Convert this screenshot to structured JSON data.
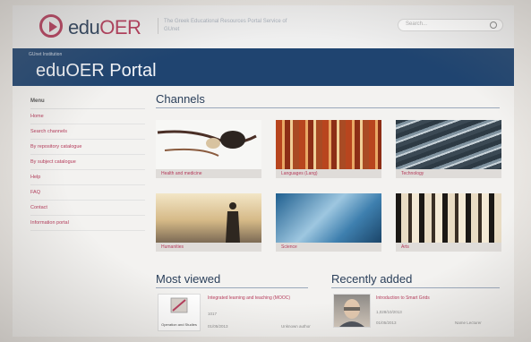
{
  "header": {
    "logo_prefix": "edu",
    "logo_suffix": "OER",
    "tagline": "The Greek Educational Resources Portal Service of GUnet",
    "search_placeholder": "Search..."
  },
  "banner": {
    "breadcrumb": "GUnet Institution",
    "title": "eduOER Portal"
  },
  "sidebar": {
    "heading": "Menu",
    "items": [
      {
        "label": "Home"
      },
      {
        "label": "Search channels"
      },
      {
        "label": "By repository catalogue"
      },
      {
        "label": "By subject catalogue"
      },
      {
        "label": "Help"
      },
      {
        "label": "FAQ"
      },
      {
        "label": "Contact"
      },
      {
        "label": "Information portal"
      }
    ]
  },
  "channels": {
    "title": "Channels",
    "tiles": [
      {
        "label": "Health and medicine"
      },
      {
        "label": "Languages (Lang)"
      },
      {
        "label": "Technology"
      },
      {
        "label": "Humanities"
      },
      {
        "label": "Science"
      },
      {
        "label": "Arts"
      }
    ]
  },
  "most_viewed": {
    "title": "Most viewed",
    "item_title": "Integrated learning and teaching (MOOC)",
    "thumb_caption": "Operation and Studies",
    "views": "1017",
    "date": "01/05/2013",
    "author": "Unknown author"
  },
  "recently_added": {
    "title": "Recently added",
    "item_title": "Introduction to Smart Grids",
    "date_line": "1,028/10/2013",
    "date2": "01/05/2013",
    "author": "Name Lecturer"
  },
  "colors": {
    "accent": "#b53a5a",
    "banner": "#1f4470",
    "text": "#2a3f5a"
  }
}
